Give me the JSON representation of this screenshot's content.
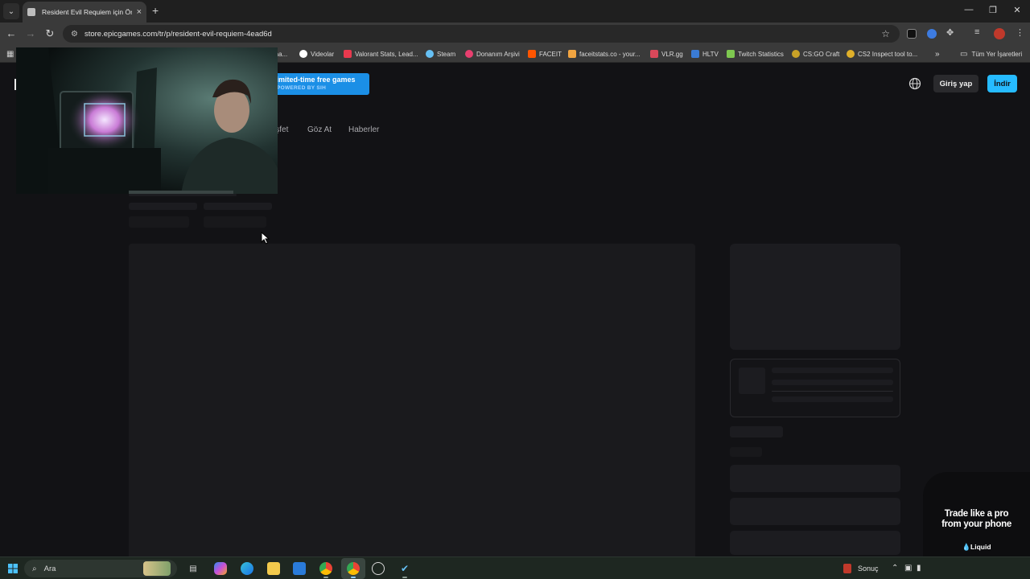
{
  "browser": {
    "tab": {
      "title": "Resident Evil Requiem için Ön S",
      "close": "×"
    },
    "new_tab": "+",
    "window_controls": {
      "minimize": "—",
      "restore": "❐",
      "close": "✕"
    },
    "url": "store.epicgames.com/tr/p/resident-evil-requiem-4ead6d",
    "bookmarks": [
      {
        "label": "...na...",
        "color": "#888888"
      },
      {
        "label": "Videolar",
        "color": "#4285f4"
      },
      {
        "label": "Valorant Stats, Lead...",
        "color": "#e8394e"
      },
      {
        "label": "Steam",
        "color": "#66c0f4"
      },
      {
        "label": "Donanım Arşivi",
        "color": "#e83f6f"
      },
      {
        "label": "FACEIT",
        "color": "#ff5500"
      },
      {
        "label": "faceitstats.co - your...",
        "color": "#f2a541"
      },
      {
        "label": "VLR.gg",
        "color": "#d9485a"
      },
      {
        "label": "HLTV",
        "color": "#3a7bd5"
      },
      {
        "label": "Twitch Statistics",
        "color": "#7ec850"
      },
      {
        "label": "CS:GO Craft",
        "color": "#c9a227"
      },
      {
        "label": "CS2 Inspect tool to...",
        "color": "#e0b02a"
      }
    ],
    "bookmarks_more": "»",
    "all_bookmarks": "Tüm Yer İşaretleri"
  },
  "epic": {
    "promo": {
      "title": "Limited-time free games",
      "subtitle": "POWERED BY SIH"
    },
    "header": {
      "login": "Giriş yap",
      "download": "İndir"
    },
    "subnav": [
      "Keşfet",
      "Göz At",
      "Haberler"
    ]
  },
  "ad": {
    "headline_line1": "Trade like a pro",
    "headline_line2": "from your phone",
    "brand": "Liquid"
  },
  "taskbar": {
    "search_placeholder": "Ara",
    "tray_label": "Sonuç"
  },
  "colors": {
    "epic_blue": "#26bbff",
    "promo_blue": "#1b8fe6",
    "page_bg": "#121215"
  }
}
